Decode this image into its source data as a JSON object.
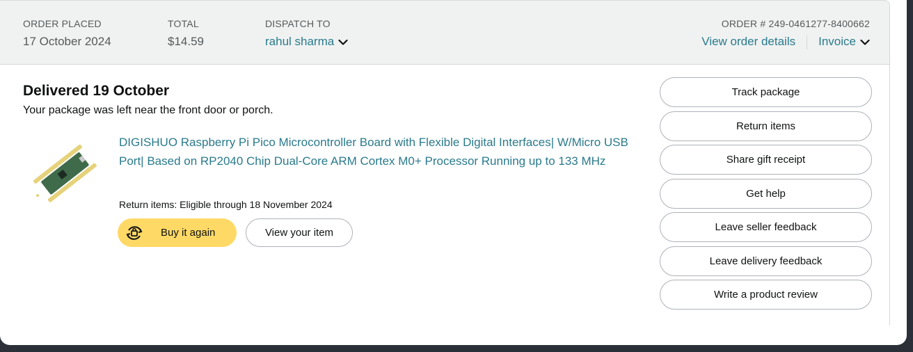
{
  "header": {
    "order_placed_label": "ORDER PLACED",
    "order_placed_value": "17 October 2024",
    "total_label": "TOTAL",
    "total_value": "$14.59",
    "dispatch_label": "DISPATCH TO",
    "dispatch_value": "rahul sharma",
    "order_number_label": "ORDER # 249-0461277-8400662",
    "view_details_link": "View order details",
    "invoice_link": "Invoice"
  },
  "shipment": {
    "status_title": "Delivered 19 October",
    "status_sub": "Your package was left near the front door or porch."
  },
  "item": {
    "title": "DIGISHUO Raspberry Pi Pico Microcontroller Board with Flexible Digital Interfaces| W/Micro USB Port| Based on RP2040 Chip Dual-Core ARM Cortex M0+ Processor Running up to 133 MHz",
    "return_note": "Return items: Eligible through 18 November 2024",
    "buy_again_label": "Buy it again",
    "view_item_label": "View your item"
  },
  "actions": [
    {
      "label": "Track package"
    },
    {
      "label": "Return items"
    },
    {
      "label": "Share gift receipt"
    },
    {
      "label": "Get help"
    },
    {
      "label": "Leave seller feedback"
    },
    {
      "label": "Leave delivery feedback"
    },
    {
      "label": "Write a product review"
    }
  ],
  "colors": {
    "link": "#2a7a8c",
    "buy_button": "#ffd966",
    "header_bg": "#f0f2f2",
    "outer_bg": "#2b3038"
  }
}
